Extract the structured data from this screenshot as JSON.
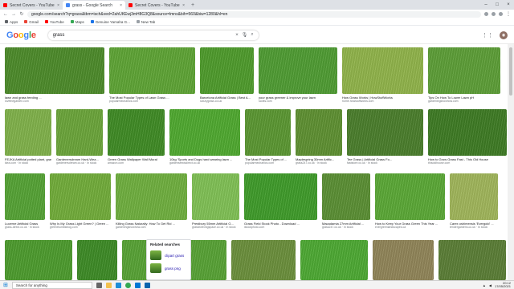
{
  "browser": {
    "tabs": [
      {
        "title": "Secret Covers - YouTube",
        "color": "#ff0000"
      },
      {
        "title": "grass - Google Search",
        "color": "#4285f4",
        "active": true
      },
      {
        "title": "Secret Covers - YouTube",
        "color": "#ff0000"
      }
    ],
    "new_tab": "+",
    "url": "google.com/search?q=grass&tbm=isch&ved=2ahUKEwj3mH8G3Q8&source=lmns&bih=560&biw=1280&hl=en",
    "bookmarks": [
      {
        "label": "Apps",
        "color": "#5f6368"
      },
      {
        "label": "Gmail",
        "color": "#ea4335"
      },
      {
        "label": "YouTube",
        "color": "#ff0000"
      },
      {
        "label": "Maps",
        "color": "#34a853"
      },
      {
        "label": "Genuine Yamaha G...",
        "color": "#1a73e8"
      },
      {
        "label": "New Tab",
        "color": "#9aa0a6"
      }
    ]
  },
  "search": {
    "logo": "Google",
    "query": "grass"
  },
  "results": [
    {
      "cap": "lawn and grass feeding ...",
      "src": "lovethegarden.com",
      "color": "#4c8a2a"
    },
    {
      "cap": "The Most Popular Types of Lawn Grass ...",
      "src": "popularmechanics.com",
      "color": "#5ea335"
    },
    {
      "cap": "Barcelona Artificial Grass | Best A...",
      "src": "luxurygrass.co.uk",
      "color": "#4e9a2c"
    },
    {
      "cap": "your grass greener & improve your lawn",
      "src": "scotts.com",
      "color": "#4f9b33"
    },
    {
      "cap": "How Grass Works | HowStuffWorks",
      "src": "home.howstuffworks.com",
      "color": "#8fb24a"
    },
    {
      "cap": "Tips On How To Lower Lawn pH",
      "src": "gardeningknowhow.com",
      "color": "#5c9d37"
    },
    {
      "cap": "FEJKA Artificial potted plant, grass ...",
      "src": "ikea.com · In stock",
      "color": "#7fb04a"
    },
    {
      "cap": "Gardenersdream Hard-Wea...",
      "src": "gardenersdream.co.uk · In stock",
      "color": "#6aa43a"
    },
    {
      "cap": "Green Grass Wallpaper Wall Mural",
      "src": "amazon.com",
      "color": "#3f8a25"
    },
    {
      "cap": "10kg 'Sports and Dogs hard wearing lawn ...",
      "src": "gardenseedsdirect.co.uk",
      "color": "#4fa830"
    },
    {
      "cap": "The Most Popular Types of ...",
      "src": "popularmechanics.com",
      "color": "#5a9632"
    },
    {
      "cap": "Maplespring 30mm Artific...",
      "src": "grass247.co.uk · In stock",
      "color": "#5e8f32"
    },
    {
      "cap": "Tee Grass | Artificial Grass Fo...",
      "src": "faststore.co.uk · In stock",
      "color": "#4a7d2c"
    },
    {
      "cap": "How to Grow Grass Fast - This Old House",
      "src": "thisoldhouse.com",
      "color": "#3e7a24"
    },
    {
      "cap": "Lucerne Artificial Grass",
      "src": "grass-direct.co.uk · In stock",
      "color": "#55a235"
    },
    {
      "cap": "Why Is My Grass Light Green? | Green ...",
      "src": "greenthumbsblog.com",
      "color": "#71ab3a"
    },
    {
      "cap": "Killing Grass Naturally: How To Get Rid ...",
      "src": "gardeningknowhow.com",
      "color": "#6fae3f"
    },
    {
      "cap": "Prestbury 55mm Artificial G...",
      "src": "grassforlivingspace.co.uk · In stock",
      "color": "#7fbf55"
    },
    {
      "cap": "Grass Field Stock Photo - Download ...",
      "src": "istockphoto.com",
      "color": "#3f9a2a"
    },
    {
      "cap": "Macadamia 27mm Artificial ...",
      "src": "grass247.co.uk · In stock",
      "color": "#5a8e34"
    },
    {
      "cap": "How to Keep Your Grass Green This Year ...",
      "src": "evergreenlandscapes.ca",
      "color": "#5aa736"
    },
    {
      "cap": "Carex oshimensis 'Evergold' ...",
      "src": "tendergardens.co.uk · In stock",
      "color": "#9fb45a"
    },
    {
      "cap": "",
      "src": "",
      "color": "#4c9a2e"
    },
    {
      "cap": "",
      "src": "",
      "color": "#3d8a26"
    },
    {
      "cap": "",
      "src": "",
      "color": "#57a135"
    },
    {
      "cap": "",
      "src": "",
      "color": "#6a8e3c"
    },
    {
      "cap": "",
      "src": "",
      "color": "#4da833"
    },
    {
      "cap": "",
      "src": "",
      "color": "#8f8458"
    },
    {
      "cap": "",
      "src": "",
      "color": "#5a7d36"
    }
  ],
  "related": {
    "heading": "Related searches",
    "items": [
      {
        "label": "clipart grass"
      },
      {
        "label": "grass png"
      }
    ]
  },
  "taskbar": {
    "search_placeholder": "Search for anything",
    "time": "20:12",
    "date": "17/05/2021"
  }
}
